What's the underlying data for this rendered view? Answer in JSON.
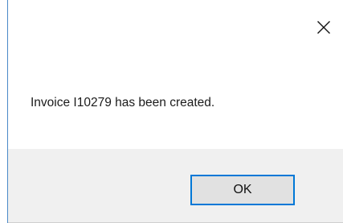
{
  "dialog": {
    "close_icon": "close-icon",
    "message": "Invoice I10279 has been created.",
    "ok_label": "OK"
  },
  "colors": {
    "accent": "#0078d7",
    "button_bar": "#f0f0f0",
    "button_face": "#e1e1e1"
  }
}
